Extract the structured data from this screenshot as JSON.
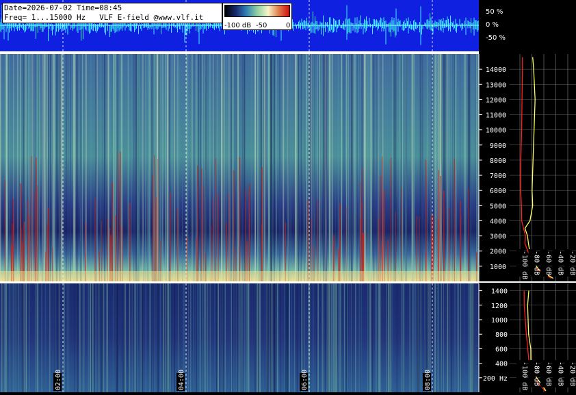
{
  "header": {
    "date_line": "Date=2026-07-02 Time=08:45",
    "freq_line": "Freq= 1...15000 Hz   VLF E-field @www.vlf.it"
  },
  "legend": {
    "labels": [
      "-100 dB",
      "-50",
      "0"
    ],
    "colors": [
      "#000000",
      "#1a2a6e",
      "#2f7fb5",
      "#8ed0a0",
      "#f5f5c8",
      "#e08050",
      "#d01010"
    ]
  },
  "waveform": {
    "scale_labels": [
      "50 %",
      "0 %",
      "-50 %"
    ],
    "background": "#1020e0",
    "trace_color": "#40f0ff"
  },
  "time_labels": [
    "02:00",
    "04:00",
    "06:00",
    "08:00"
  ],
  "chart_data": [
    {
      "type": "heatmap",
      "name": "upper_spectrogram",
      "ylim": [
        0,
        15000
      ],
      "y_ticks": [
        1000,
        2000,
        3000,
        4000,
        5000,
        6000,
        7000,
        8000,
        9000,
        10000,
        11000,
        12000,
        13000,
        14000
      ],
      "y_tick_labels": [
        "1000",
        "2000",
        "3000",
        "4000",
        "5000",
        "6000",
        "7000",
        "8000",
        "9000",
        "10000",
        "11000",
        "12000",
        "13000",
        "14000"
      ],
      "x_tick_labels": [
        "02:00",
        "04:00",
        "06:00",
        "08:00"
      ]
    },
    {
      "type": "heatmap",
      "name": "lower_spectrogram",
      "ylim": [
        0,
        1500
      ],
      "y_ticks": [
        200,
        400,
        600,
        800,
        1000,
        1200,
        1400
      ],
      "y_tick_labels": [
        "200 Hz",
        "400",
        "600",
        "800",
        "1000",
        "1200",
        "1400"
      ]
    },
    {
      "type": "line",
      "name": "upper_spectrum_profile",
      "x_axis_labels": [
        "-100 dB",
        "-80 dB",
        "-60 dB",
        "-40 dB",
        "-20 dB"
      ],
      "y_freq_hz": [
        200,
        800,
        1500,
        2500,
        3000,
        3500,
        4000,
        5000,
        6000,
        8000,
        10000,
        12000,
        14000,
        14800
      ],
      "series": [
        {
          "color": "#ff2020",
          "values_db": [
            -48,
            -70,
            -82,
            -90,
            -92,
            -95,
            -97,
            -97,
            -98,
            -97,
            -97,
            -97,
            -97,
            -97
          ]
        },
        {
          "color": "#ffff60",
          "values_db": [
            -45,
            -68,
            -80,
            -86,
            -88,
            -90,
            -82,
            -79,
            -78,
            -77,
            -78,
            -76,
            -77,
            -79
          ]
        }
      ]
    },
    {
      "type": "line",
      "name": "lower_spectrum_profile",
      "x_axis_labels": [
        "-100 dB",
        "-80 dB",
        "-60 dB",
        "-40 dB",
        "-20 dB"
      ],
      "y_freq_hz": [
        20,
        100,
        200,
        300,
        400,
        600,
        800,
        1000,
        1200,
        1400
      ],
      "series": [
        {
          "color": "#ff2020",
          "values_db": [
            -58,
            -66,
            -74,
            -80,
            -84,
            -88,
            -90,
            -91,
            -92,
            -92
          ]
        },
        {
          "color": "#ffff60",
          "values_db": [
            -55,
            -62,
            -72,
            -78,
            -80,
            -83,
            -84,
            -85,
            -86,
            -86
          ]
        }
      ]
    }
  ]
}
